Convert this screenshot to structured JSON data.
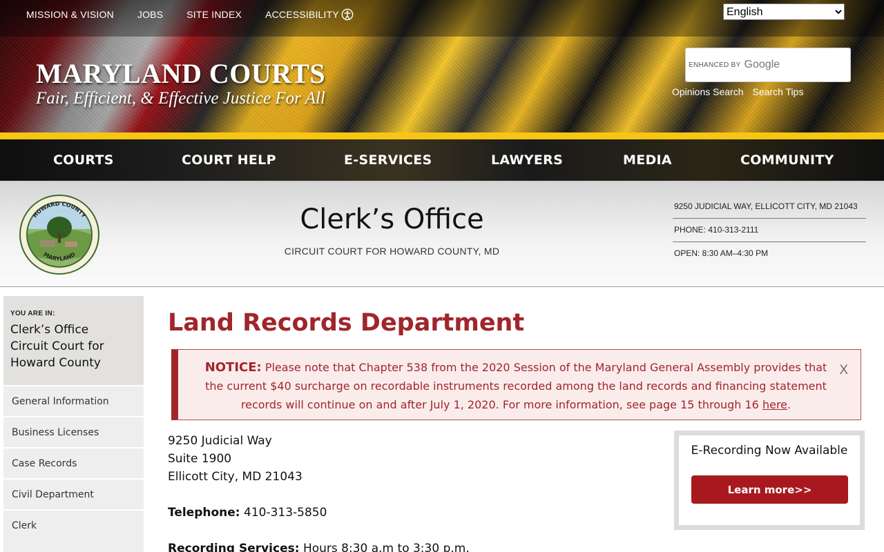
{
  "utility_links": {
    "mission": "MISSION & VISION",
    "jobs": "JOBS",
    "site_index": "SITE INDEX",
    "accessibility": "ACCESSIBILITY"
  },
  "language": {
    "selected": "English"
  },
  "site": {
    "title": "MARYLAND COURTS",
    "tagline": "Fair, Efficient, & Effective Justice For All"
  },
  "search": {
    "enhanced_by": "ENHANCED BY",
    "provider": "Google",
    "links": {
      "opinions": "Opinions Search",
      "tips": "Search Tips"
    }
  },
  "main_nav": {
    "courts": "COURTS",
    "court_help": "COURT HELP",
    "eservices": "E-SERVICES",
    "lawyers": "LAWYERS",
    "media": "MEDIA",
    "community": "COMMUNITY"
  },
  "court_header": {
    "title": "Clerk’s Office",
    "subtitle": "CIRCUIT COURT FOR HOWARD COUNTY, MD",
    "seal_top": "HOWARD COUNTY",
    "seal_bottom": "MARYLAND",
    "info": {
      "address": "9250 JUDICIAL WAY, ELLICOTT CITY, MD 21043",
      "phone": "PHONE: 410-313-2111",
      "hours": "OPEN: 8:30 AM–4:30 PM"
    }
  },
  "sidebar": {
    "you_are_in_label": "YOU ARE IN:",
    "current_line1": "Clerk’s Office",
    "current_line2": "Circuit Court for",
    "current_line3": "Howard County",
    "items": [
      "General Information",
      "Business Licenses",
      "Case Records",
      "Civil Department",
      "Clerk"
    ]
  },
  "page": {
    "heading": "Land Records Department",
    "notice": {
      "label": "NOTICE:",
      "text": " Please note that Chapter 538 from the 2020 Session of the Maryland General Assembly provides that the current $40 surcharge on recordable instruments recorded among the land records and financing statement records will continue on and after July 1, 2020. For more information, see page 15 through 16 ",
      "link": "here",
      "period": ".",
      "close": "X"
    },
    "address": {
      "line1": "9250 Judicial Way",
      "line2": "Suite 1900",
      "line3": "Ellicott City, MD 21043"
    },
    "telephone_label": "Telephone:",
    "telephone_value": " 410-313-5850",
    "recording_label": "Recording Services:",
    "recording_value": " Hours 8:30 a.m to 3:30 p.m."
  },
  "erecording": {
    "title": "E-Recording Now Available",
    "button": "Learn more>>"
  },
  "colors": {
    "accent_red": "#a0262b",
    "nav_gold": "#f7c613",
    "button_red": "#a8191f"
  }
}
